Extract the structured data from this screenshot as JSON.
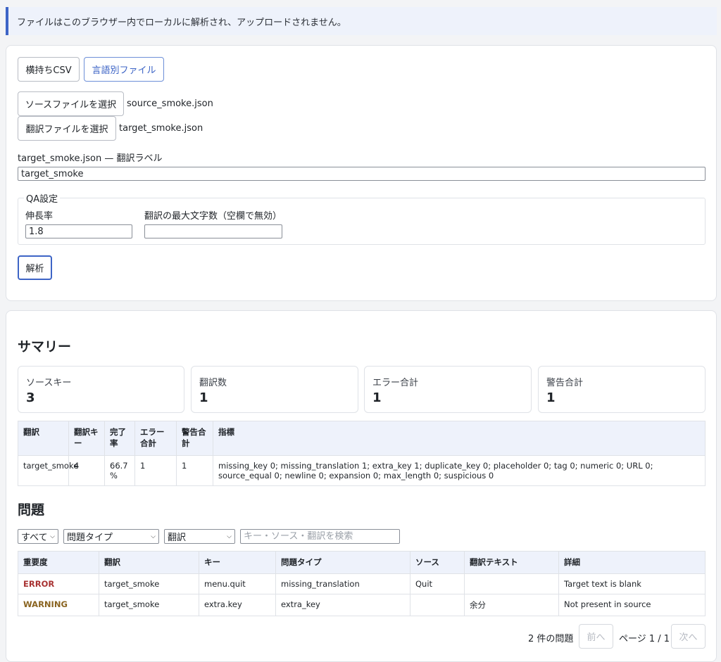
{
  "notice": "ファイルはこのブラウザー内でローカルに解析され、アップロードされません。",
  "modes": {
    "csv": "横持ちCSV",
    "per_lang": "言語別ファイル"
  },
  "source": {
    "button": "ソースファイルを選択",
    "filename": "source_smoke.json"
  },
  "target": {
    "button": "翻訳ファイルを選択",
    "filename": "target_smoke.json"
  },
  "label_field": {
    "label": "target_smoke.json — 翻訳ラベル",
    "value": "target_smoke"
  },
  "qa": {
    "legend": "QA設定",
    "expansion_label": "伸長率",
    "expansion_value": "1.8",
    "maxlen_label": "翻訳の最大文字数（空欄で無効）",
    "maxlen_value": ""
  },
  "analyze_button": "解析",
  "summary": {
    "title": "サマリー",
    "stats": [
      {
        "label": "ソースキー",
        "value": "3"
      },
      {
        "label": "翻訳数",
        "value": "1"
      },
      {
        "label": "エラー合計",
        "value": "1"
      },
      {
        "label": "警告合計",
        "value": "1"
      }
    ],
    "table": {
      "headers": [
        "翻訳",
        "翻訳キー",
        "完了率",
        "エラー合計",
        "警告合計",
        "指標"
      ],
      "rows": [
        [
          "target_smoke",
          "4",
          "66.7 %",
          "1",
          "1",
          "missing_key 0; missing_translation 1; extra_key 1; duplicate_key 0; placeholder 0; tag 0; numeric 0; URL 0; source_equal 0; newline 0; expansion 0; max_length 0; suspicious 0"
        ]
      ]
    }
  },
  "issues": {
    "title": "問題",
    "filters": {
      "severity": "すべて",
      "type": "問題タイプ",
      "translation": "翻訳",
      "search_placeholder": "キー・ソース・翻訳を検索"
    },
    "headers": [
      "重要度",
      "翻訳",
      "キー",
      "問題タイプ",
      "ソース",
      "翻訳テキスト",
      "詳細"
    ],
    "rows": [
      [
        "ERROR",
        "target_smoke",
        "menu.quit",
        "missing_translation",
        "Quit",
        "",
        "Target text is blank"
      ],
      [
        "WARNING",
        "target_smoke",
        "extra.key",
        "extra_key",
        "",
        "余分",
        "Not present in source"
      ]
    ],
    "count": "2 件の問題",
    "prev": "前へ",
    "page": "ページ 1 / 1",
    "next": "次へ"
  }
}
